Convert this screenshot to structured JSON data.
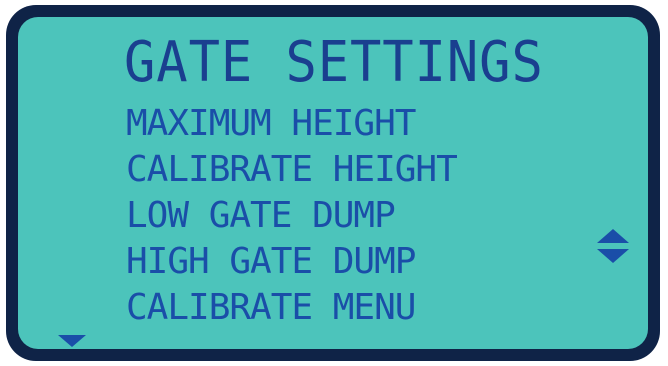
{
  "screen": {
    "title": "GATE SETTINGS",
    "menu_items": [
      {
        "label": "MAXIMUM HEIGHT"
      },
      {
        "label": "CALIBRATE HEIGHT"
      },
      {
        "label": "LOW GATE DUMP"
      },
      {
        "label": "HIGH GATE DUMP"
      },
      {
        "label": "CALIBRATE MENU"
      }
    ],
    "icons": {
      "scroll_indicator": "up-down-arrows-icon",
      "more_below_indicator": "arrow-down-icon"
    },
    "colors": {
      "background": "#4cc4bb",
      "bezel": "#0f2347",
      "title_text": "#1a3f8f",
      "item_text": "#1a4ea8"
    }
  }
}
